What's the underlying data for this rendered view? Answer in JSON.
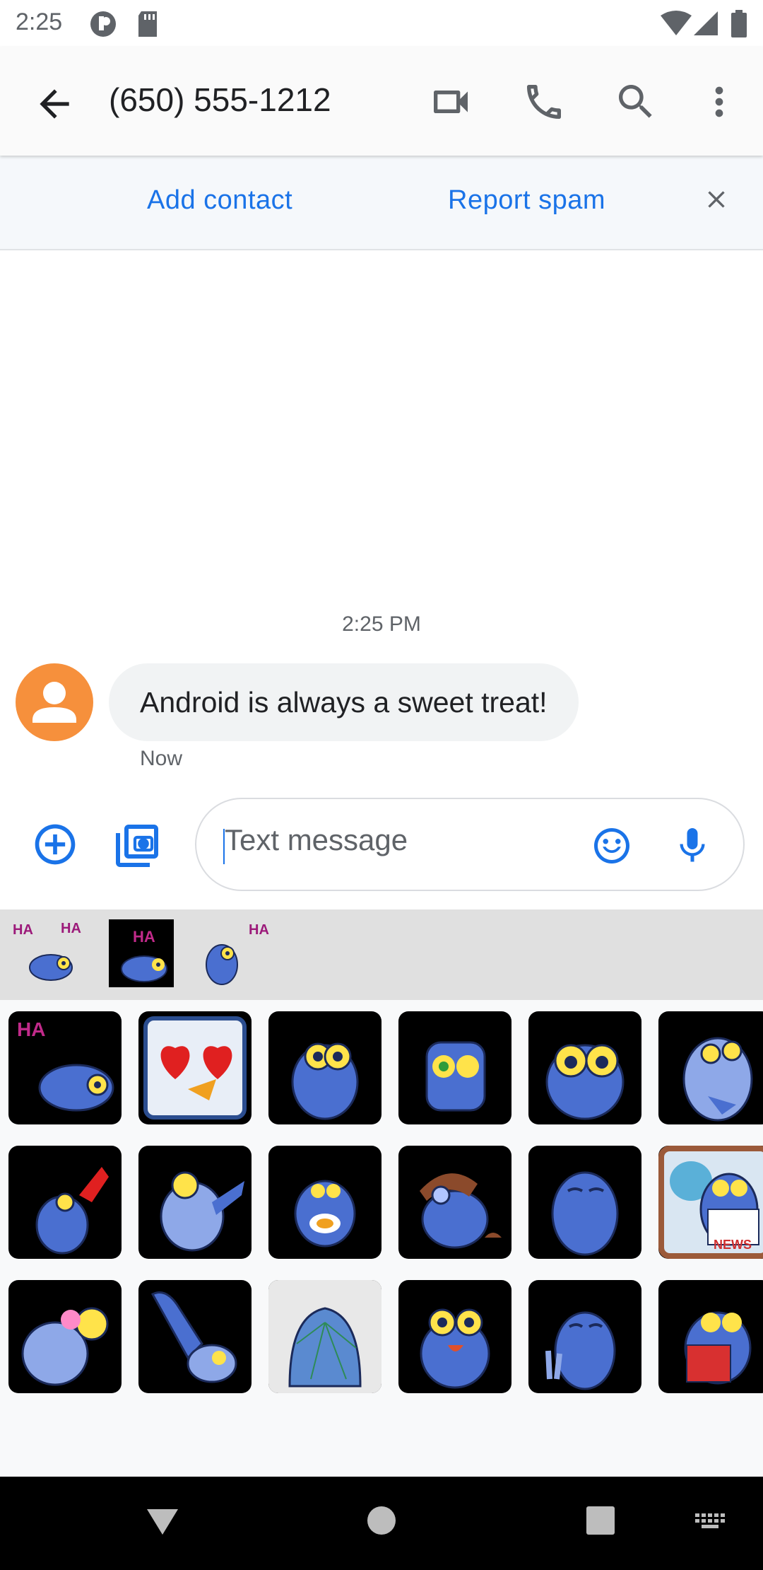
{
  "status_bar": {
    "time": "2:25",
    "icons": [
      "notification-dot-icon",
      "sd-card-icon",
      "wifi-icon",
      "signal-icon",
      "battery-icon"
    ]
  },
  "app_bar": {
    "title": "(650) 555-1212",
    "icons": [
      "back-arrow-icon",
      "video-call-icon",
      "phone-icon",
      "search-icon",
      "more-vert-icon"
    ]
  },
  "banner": {
    "add_contact": "Add contact",
    "report_spam": "Report spam"
  },
  "conversation": {
    "timestamp": "2:25 PM",
    "message": {
      "text": "Android is always a sweet treat!",
      "time": "Now"
    }
  },
  "compose": {
    "placeholder": "Text message"
  },
  "colors": {
    "accent": "#1a73e8",
    "avatar": "#f6903c",
    "bubble": "#f1f3f4",
    "sticker_bird": "#4a6fd0"
  },
  "stickers": {
    "recent": [
      "bird-laughing-sticker",
      "bird-laughing-sticker",
      "bird-laughing-sticker"
    ],
    "recent_captions": [
      "HA",
      "HA",
      "HA"
    ],
    "grid": [
      "bird-laughing-sticker",
      "hearts-sticker",
      "bird-staring-sticker",
      "bird-money-eyes-sticker",
      "bird-big-eyes-sticker",
      "bird-thinking-sticker",
      "bird-waving-sticker",
      "bird-dabbing-sticker",
      "bird-eating-sticker",
      "bird-aviator-sticker",
      "bird-calm-sticker",
      "bird-news-sticker",
      "bird-love-sticker",
      "bird-thumbs-up-sticker",
      "bird-cracked-sticker",
      "bird-excited-sticker",
      "bird-peace-sticker",
      "bird-reading-sticker"
    ],
    "laugh_captions": [
      "HA",
      "HA"
    ],
    "news_caption": "NEWS"
  },
  "nav_bar": {
    "icons": [
      "back-triangle-icon",
      "home-circle-icon",
      "recents-square-icon",
      "keyboard-icon"
    ]
  }
}
